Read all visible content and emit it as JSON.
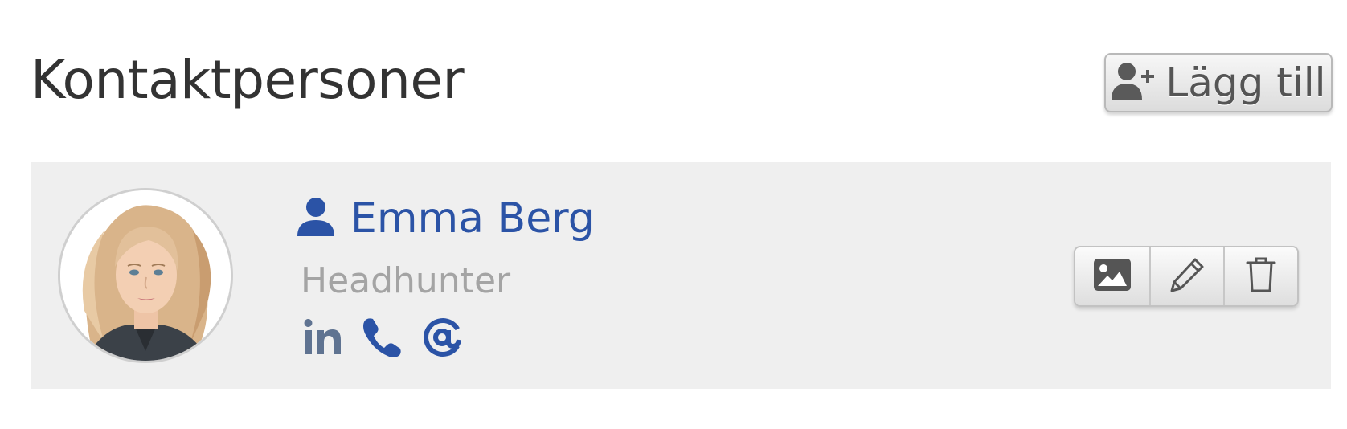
{
  "header": {
    "title": "Kontaktpersoner",
    "add_button_label": "Lägg till",
    "add_button_icon": "user-plus-icon"
  },
  "contact": {
    "name": "Emma Berg",
    "role": "Headhunter",
    "name_icon": "user-icon",
    "avatar": "profile-photo",
    "social": [
      "linkedin-icon",
      "phone-icon",
      "at-icon"
    ],
    "actions": [
      "image-icon",
      "pencil-icon",
      "trash-icon"
    ]
  },
  "colors": {
    "title": "#333333",
    "link_blue": "#2b53a6",
    "linkedin_gray": "#5f7391",
    "role_gray": "#a4a4a4",
    "card_bg": "#efefef",
    "button_text": "#555555"
  }
}
